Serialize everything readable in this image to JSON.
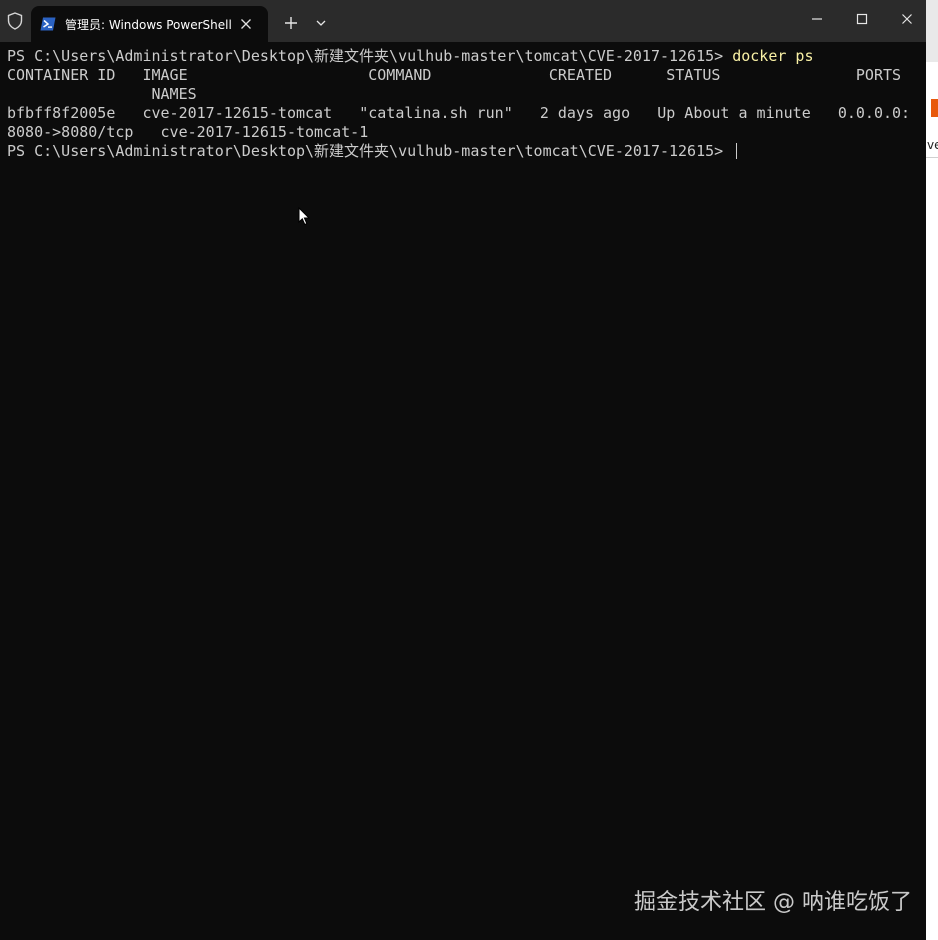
{
  "window": {
    "tab_title": "管理员: Windows PowerShell",
    "icons": {
      "shield": "shield-icon",
      "powershell": "powershell-icon",
      "tab_close": "close-icon",
      "new_tab": "plus-icon",
      "dropdown": "chevron-down-icon",
      "minimize": "minimize-icon",
      "maximize": "maximize-icon",
      "close": "close-icon"
    }
  },
  "terminal": {
    "prompt": "PS C:\\Users\\Administrator\\Desktop\\新建文件夹\\vulhub-master\\tomcat\\CVE-2017-12615> ",
    "command": "docker ps",
    "output": [
      "CONTAINER ID   IMAGE                    COMMAND             CREATED      STATUS               PORTS",
      "                NAMES",
      "bfbff8f2005e   cve-2017-12615-tomcat   \"catalina.sh run\"   2 days ago   Up About a minute   0.0.0.0:",
      "8080->8080/tcp   cve-2017-12615-tomcat-1"
    ],
    "prompt2": "PS C:\\Users\\Administrator\\Desktop\\新建文件夹\\vulhub-master\\tomcat\\CVE-2017-12615> "
  },
  "background_window": {
    "visible_text": "ve"
  },
  "watermark": "掘金技术社区 @ 呐谁吃饭了",
  "colors": {
    "terminal_bg": "#0c0c0c",
    "titlebar_bg": "#2b2b2b",
    "text": "#cccccc",
    "command": "#f9f1a5",
    "powershell_blue": "#2b62c2"
  }
}
